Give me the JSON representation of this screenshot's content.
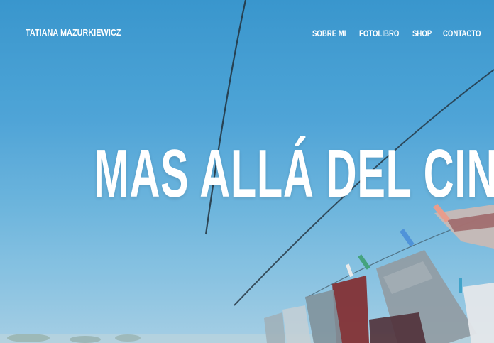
{
  "site": {
    "brand": "TATIANA MAZURKIEWICZ"
  },
  "nav": [
    {
      "label": "SOBRE MI"
    },
    {
      "label": "FOTOLIBRO"
    },
    {
      "label": "SHOP"
    },
    {
      "label": "CONTACTO"
    }
  ],
  "hero": {
    "title": "MAS ALLÁ DEL CINE"
  },
  "colors": {
    "sky_top": "#3393cc",
    "sky_bottom": "#a2cde4",
    "text": "#ffffff"
  }
}
